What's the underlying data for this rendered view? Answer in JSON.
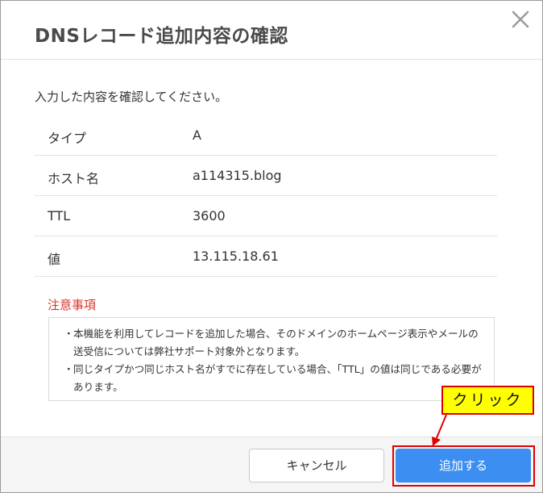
{
  "dialog": {
    "title": "DNSレコード追加内容の確認",
    "close_icon": "close-icon"
  },
  "intro": "入力した内容を確認してください。",
  "records": [
    {
      "label": "タイプ",
      "value": "A"
    },
    {
      "label": "ホスト名",
      "value": "a114315.blog"
    },
    {
      "label": "TTL",
      "value": "3600"
    },
    {
      "label": "値",
      "value": "13.115.18.61"
    }
  ],
  "notice": {
    "heading": "注意事項",
    "items": [
      {
        "bullet": "・",
        "text": "本機能を利用してレコードを追加した場合、そのドメインのホームページ表示やメールの送受信については弊社サポート対象外となります。"
      },
      {
        "bullet": "・",
        "text": "同じタイプかつ同じホスト名がすでに存在している場合、「TTL」の値は同じである必要があります。"
      }
    ]
  },
  "buttons": {
    "cancel": "キャンセル",
    "add": "追加する"
  },
  "annotation": {
    "callout": "クリック"
  },
  "colors": {
    "primary_button": "#3c8ef0",
    "notice_heading": "#d9342b",
    "highlight_border": "#e00000",
    "callout_background": "#ffff00"
  }
}
